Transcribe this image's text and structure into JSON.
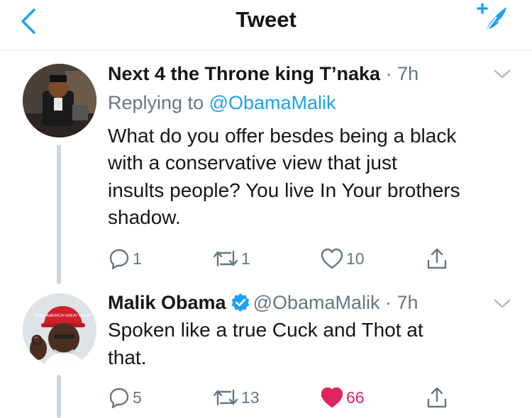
{
  "header": {
    "title": "Tweet",
    "colors": {
      "accent": "#1da1f2",
      "text": "#14171a",
      "muted": "#657786",
      "like": "#e0245e"
    }
  },
  "tweets": [
    {
      "name": "Next 4 the Throne king T’naka",
      "sep": " · ",
      "time": "7h",
      "reply_prefix": "Replying to ",
      "reply_handle": "@ObamaMalik",
      "body_lines": [
        "What do you offer besdes being a black",
        "with a conservative view that just",
        "insults people? You live In Your brothers",
        "shadow."
      ],
      "replies": "1",
      "retweets": "1",
      "likes": "10",
      "liked": false,
      "avatar_icon": "cartoon-avatar-icon"
    },
    {
      "name": "Malik Obama",
      "verified": true,
      "handle": "@ObamaMalik",
      "sep": " · ",
      "time": "7h",
      "body_lines": [
        "Spoken like a true Cuck and Thot at",
        "that."
      ],
      "replies": "5",
      "retweets": "13",
      "likes": "66",
      "liked": true,
      "avatar_icon": "photo-avatar-icon",
      "hat_text": "MAKE AMERICA GREAT AGAIN"
    }
  ]
}
